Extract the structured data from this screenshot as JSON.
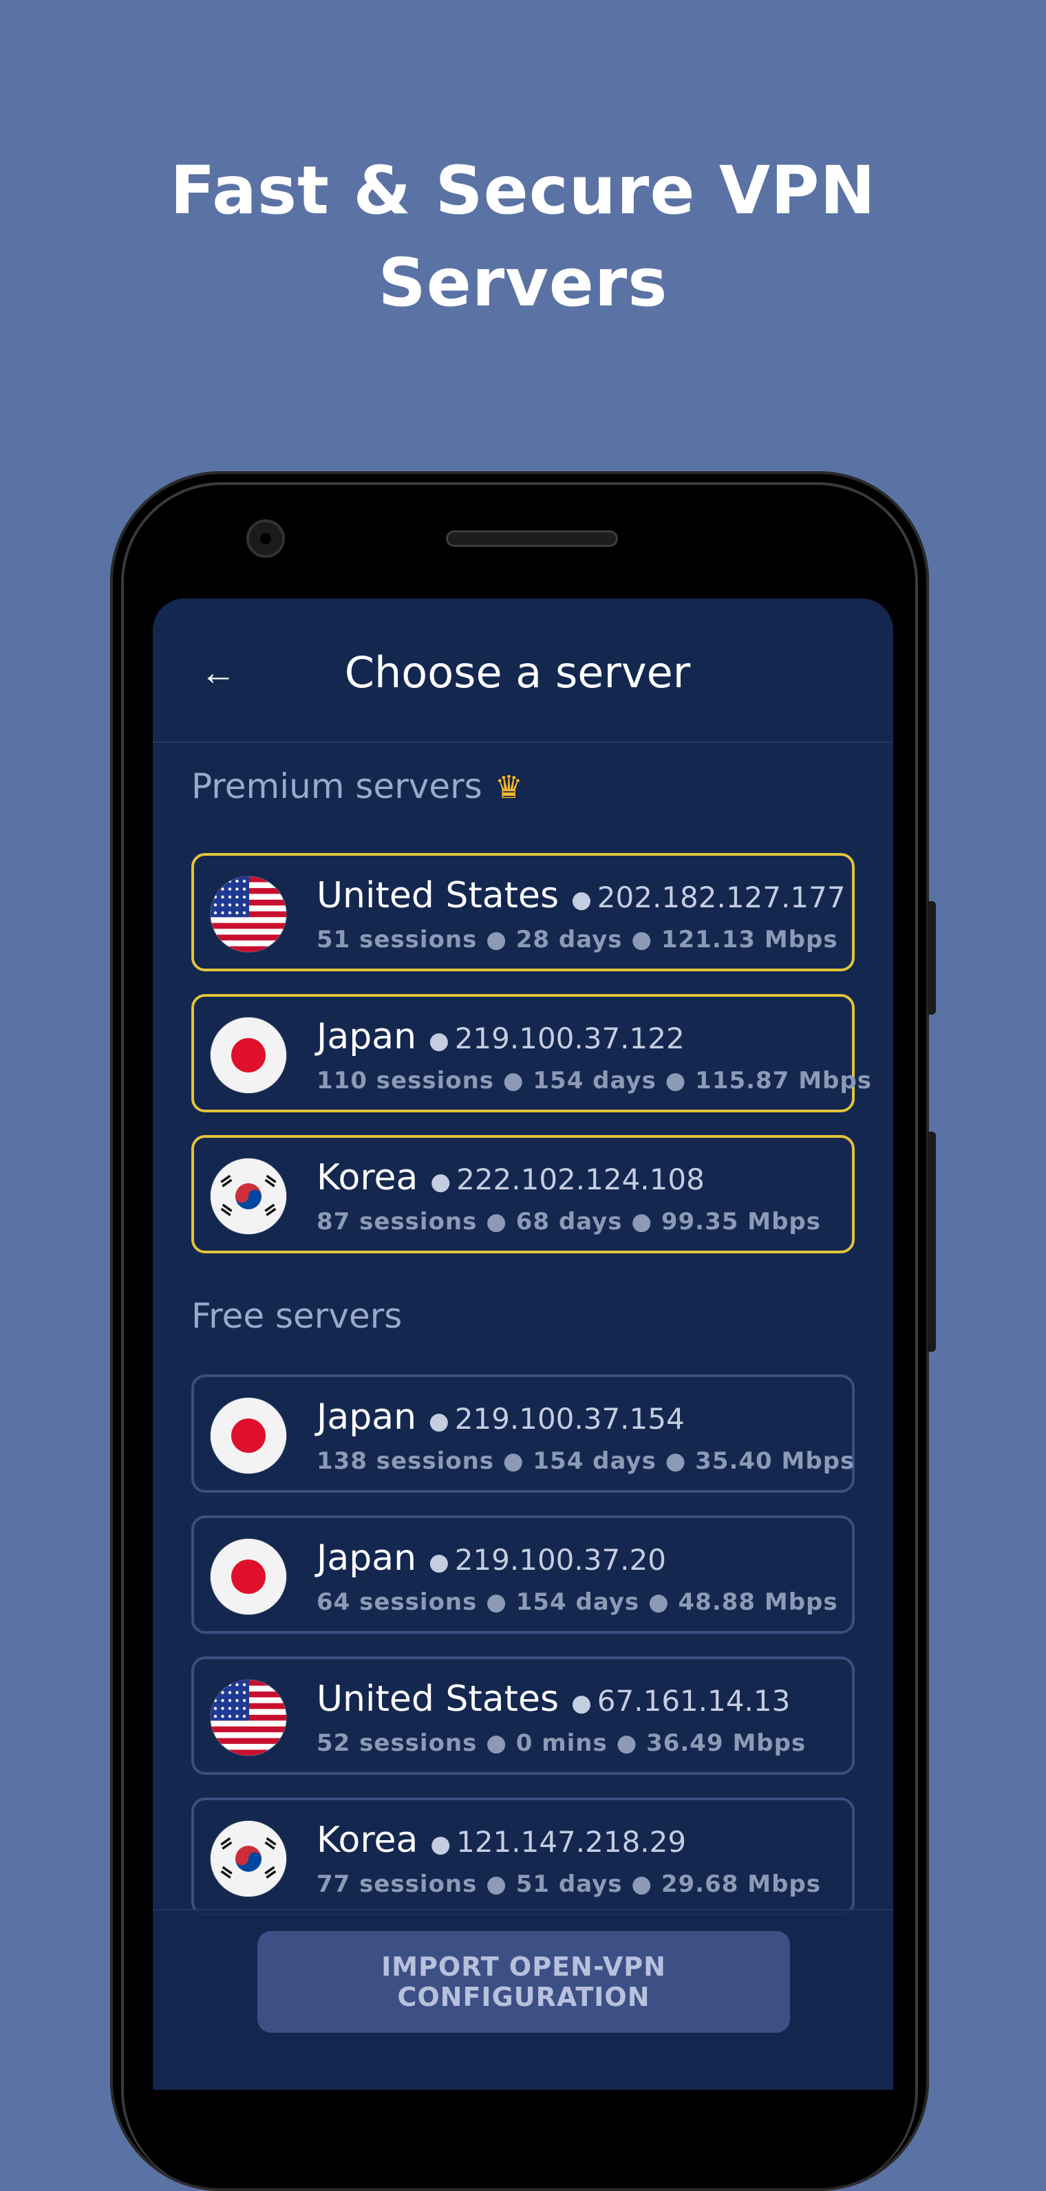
{
  "headline": {
    "line1": "Fast & Secure VPN",
    "line2": "Servers"
  },
  "screen": {
    "title": "Choose a server",
    "back_icon": "←",
    "premium_label": "Premium servers",
    "crown_icon": "♛",
    "free_label": "Free servers",
    "dot": "●",
    "premium_servers": [
      {
        "country": "United States",
        "ip": "202.182.127.177",
        "stats": "51 sessions ● 28 days ● 121.13 Mbps",
        "flag": "us-flag-icon"
      },
      {
        "country": "Japan",
        "ip": "219.100.37.122",
        "stats": "110 sessions ● 154 days ● 115.87 Mbps",
        "flag": "japan-flag-icon"
      },
      {
        "country": "Korea",
        "ip": "222.102.124.108",
        "stats": "87 sessions ● 68 days ● 99.35 Mbps",
        "flag": "korea-flag-icon"
      }
    ],
    "free_servers": [
      {
        "country": "Japan",
        "ip": "219.100.37.154",
        "stats": "138 sessions ● 154 days ● 35.40 Mbps",
        "flag": "japan-flag-icon"
      },
      {
        "country": "Japan",
        "ip": "219.100.37.20",
        "stats": "64 sessions ● 154 days ● 48.88 Mbps",
        "flag": "japan-flag-icon"
      },
      {
        "country": "United States",
        "ip": "67.161.14.13",
        "stats": "52 sessions ● 0 mins ● 36.49 Mbps",
        "flag": "us-flag-icon"
      },
      {
        "country": "Korea",
        "ip": "121.147.218.29",
        "stats": "77 sessions ● 51 days ● 29.68 Mbps",
        "flag": "korea-flag-icon"
      }
    ],
    "import_button": "IMPORT OPEN-VPN CONFIGURATION"
  },
  "colors": {
    "page_bg": "#5a73a4",
    "screen_bg": "#14274f",
    "premium_border": "#e3c33a",
    "free_border": "#3a4f80",
    "crown": "#f5b82e"
  }
}
